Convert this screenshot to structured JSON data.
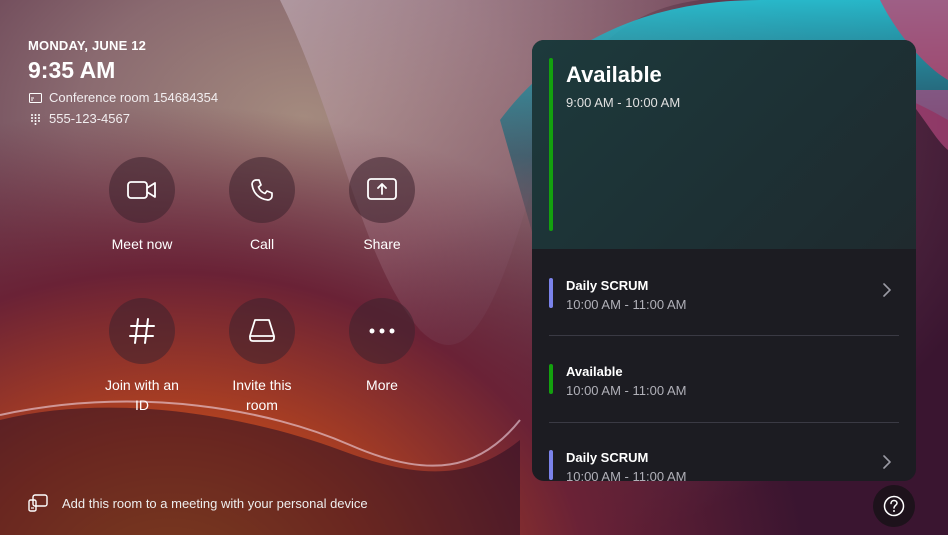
{
  "header": {
    "date": "MONDAY, JUNE 12",
    "time": "9:35 AM",
    "room": "Conference room 154684354",
    "phone": "555-123-4567"
  },
  "actions": [
    {
      "label": "Meet now",
      "icon": "video-camera-icon"
    },
    {
      "label": "Call",
      "icon": "phone-icon"
    },
    {
      "label": "Share",
      "icon": "share-screen-icon"
    },
    {
      "label": "Join with an ID",
      "icon": "hashtag-icon"
    },
    {
      "label": "Invite this room",
      "icon": "room-device-icon"
    },
    {
      "label": "More",
      "icon": "more-icon"
    }
  ],
  "footer": {
    "text": "Add this room to a meeting with your personal device"
  },
  "schedule": {
    "current": {
      "title": "Available",
      "time": "9:00 AM - 10:00 AM",
      "color": "#13a10e"
    },
    "items": [
      {
        "title": "Daily SCRUM",
        "time": "10:00 AM - 11:00 AM",
        "color": "#7b83eb"
      },
      {
        "title": "Available",
        "time": "10:00 AM - 11:00 AM",
        "color": "#13a10e"
      },
      {
        "title": "Daily SCRUM",
        "time": "10:00 AM - 11:00 AM",
        "color": "#7b83eb"
      }
    ]
  },
  "help": {
    "icon": "help-icon"
  }
}
